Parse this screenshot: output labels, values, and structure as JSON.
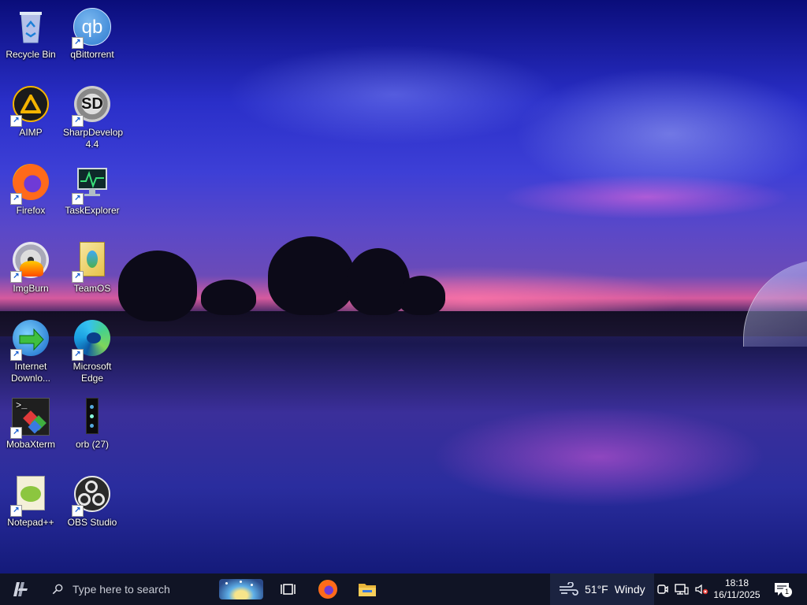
{
  "desktop": {
    "icons": [
      {
        "label": "Recycle Bin",
        "icon": "recycle-bin-icon",
        "shortcut": false
      },
      {
        "label": "qBittorrent",
        "icon": "qbittorrent-icon",
        "shortcut": true,
        "glyph_text": "qb"
      },
      {
        "label": "AIMP",
        "icon": "aimp-icon",
        "shortcut": true
      },
      {
        "label": "SharpDevelop 4.4",
        "icon": "sharpdevelop-icon",
        "shortcut": true,
        "glyph_text": "SD"
      },
      {
        "label": "Firefox",
        "icon": "firefox-icon",
        "shortcut": true
      },
      {
        "label": "TaskExplorer",
        "icon": "taskexplorer-icon",
        "shortcut": true
      },
      {
        "label": "ImgBurn",
        "icon": "imgburn-icon",
        "shortcut": true
      },
      {
        "label": "TeamOS",
        "icon": "teamos-icon",
        "shortcut": true
      },
      {
        "label": "Internet Downlo...",
        "icon": "internet-download-manager-icon",
        "shortcut": true
      },
      {
        "label": "Microsoft Edge",
        "icon": "edge-icon",
        "shortcut": true
      },
      {
        "label": "MobaXterm",
        "icon": "mobaxterm-icon",
        "shortcut": true
      },
      {
        "label": "orb (27)",
        "icon": "orb-file-icon",
        "shortcut": false
      },
      {
        "label": "Notepad++",
        "icon": "notepadpp-icon",
        "shortcut": true
      },
      {
        "label": "OBS Studio",
        "icon": "obs-studio-icon",
        "shortcut": true
      }
    ]
  },
  "taskbar": {
    "search_placeholder": "Type here to search",
    "weather": {
      "temp": "51°F",
      "condition": "Windy"
    },
    "clock": {
      "time": "18:18",
      "date": "16/11/2025"
    },
    "notification_count": "1"
  },
  "colors": {
    "taskbar_bg": "#101425",
    "weather_bg": "#1b2340",
    "accent_blue": "#1a5fd0"
  }
}
